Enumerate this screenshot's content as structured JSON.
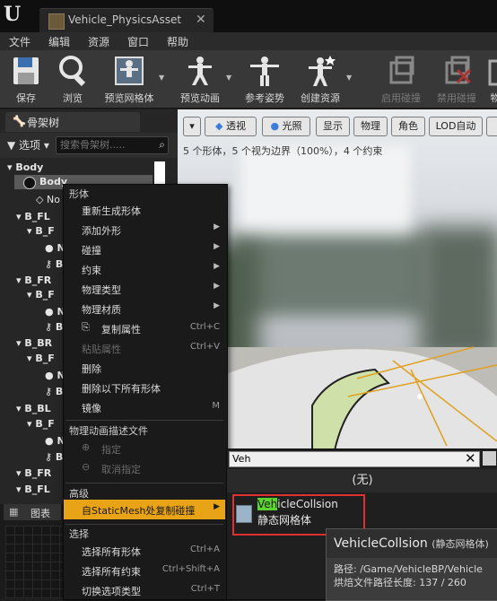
{
  "window": {
    "tab_title": "Vehicle_PhysicsAsset",
    "logo": "U"
  },
  "menu": [
    "文件",
    "编辑",
    "资源",
    "窗口",
    "帮助"
  ],
  "toolbar": [
    {
      "label": "保存",
      "icon": "save-icon"
    },
    {
      "label": "浏览",
      "icon": "browse-icon"
    },
    {
      "label": "预览网格体",
      "icon": "preview-mesh-icon"
    },
    {
      "label": "预览动画",
      "icon": "preview-anim-icon"
    },
    {
      "label": "参考姿势",
      "icon": "ref-pose-icon"
    },
    {
      "label": "创建资源",
      "icon": "create-asset-icon"
    },
    {
      "label": "启用碰撞",
      "icon": "enable-collision-icon"
    },
    {
      "label": "禁用碰撞",
      "icon": "disable-collision-icon"
    },
    {
      "label": "物",
      "icon": "physics-icon"
    }
  ],
  "left_panel": {
    "tab": "骨架树",
    "filter": "选项",
    "search_placeholder": "搜索骨架树.....",
    "tree": [
      "Body",
      "Body",
      "No",
      "B_FL",
      "B_F",
      "N",
      "B",
      "B_FR",
      "B_F",
      "N",
      "B",
      "B_BR",
      "B_F",
      "N",
      "B",
      "B_BL",
      "B_F",
      "N",
      "B",
      "B_FR",
      "B_FL"
    ]
  },
  "viewport": {
    "buttons": [
      "透视",
      "光照",
      "显示",
      "物理",
      "角色",
      "LOD自动"
    ],
    "info": "5 个形体，5 个视为边界（100%），4 个约束"
  },
  "context_menu": {
    "sections": [
      "形体",
      "物理动画描述文件",
      "高级",
      "选择"
    ],
    "items": [
      {
        "label": "重新生成形体",
        "shortcut": ""
      },
      {
        "label": "添加外形",
        "shortcut": ""
      },
      {
        "label": "碰撞",
        "shortcut": ""
      },
      {
        "label": "约束",
        "shortcut": ""
      },
      {
        "label": "物理类型",
        "shortcut": ""
      },
      {
        "label": "物理材质",
        "shortcut": ""
      },
      {
        "label": "复制属性",
        "shortcut": "Ctrl+C"
      },
      {
        "label": "粘贴属性",
        "shortcut": "Ctrl+V"
      },
      {
        "label": "删除",
        "shortcut": ""
      },
      {
        "label": "删除以下所有形体",
        "shortcut": ""
      },
      {
        "label": "镜像",
        "shortcut": "M"
      },
      {
        "label": "指定",
        "shortcut": ""
      },
      {
        "label": "取消指定",
        "shortcut": ""
      },
      {
        "label": "自StaticMesh处复制碰撞",
        "shortcut": ""
      },
      {
        "label": "选择所有形体",
        "shortcut": "Ctrl+A"
      },
      {
        "label": "选择所有约束",
        "shortcut": "Ctrl+Shift+A"
      },
      {
        "label": "切换选项类型",
        "shortcut": "Ctrl+T"
      }
    ]
  },
  "picker": {
    "search_value": "Veh",
    "none_label": "(无)",
    "result": {
      "match": "Veh",
      "rest": "icleCollsion",
      "type": "静态网格体"
    },
    "tooltip": {
      "title": "VehicleCollsion",
      "subtitle": "(静态网格体)",
      "path": "路径: /Game/VehicleBP/Vehicle",
      "cook": "烘焙文件路径长度: 137 / 260"
    }
  },
  "graph_panel": {
    "tab": "图表"
  },
  "colors": {
    "highlight": "#e8a317",
    "match": "#5cd62f",
    "outline": "#e03030"
  }
}
